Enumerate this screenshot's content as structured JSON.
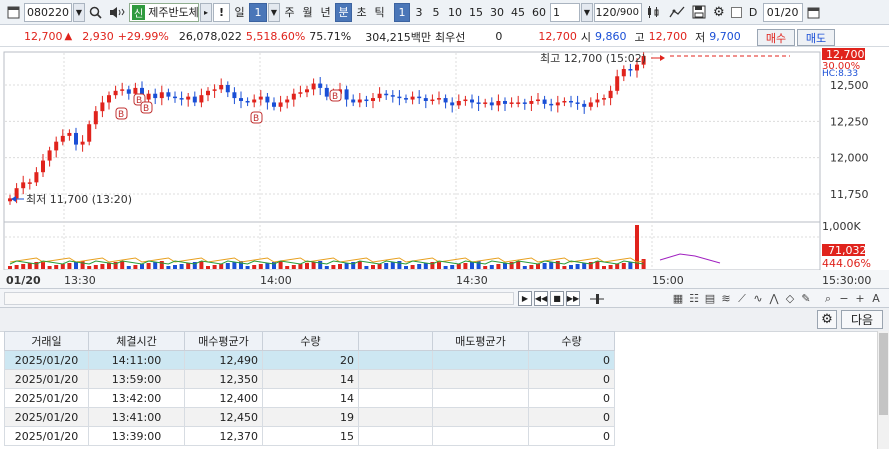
{
  "toolbar": {
    "code": "080220",
    "stock_tag": "신",
    "stock_name": "제주반도체",
    "alert": "!",
    "period_day": "일",
    "period_count": "1",
    "periods": [
      "주",
      "월",
      "년",
      "분",
      "초",
      "틱"
    ],
    "selected_period": "분",
    "minute_options": [
      "1",
      "3",
      "5",
      "10",
      "15",
      "30",
      "45",
      "60"
    ],
    "selected_minute": "1",
    "interval": "1",
    "bar_count": "120",
    "bar_total": "/900",
    "d_label": "D",
    "date": "01/20"
  },
  "quote": {
    "price": "12,700",
    "change": "2,930",
    "change_pct": "+29.99%",
    "volume": "26,078,022",
    "volume_pct": "5,518.60%",
    "rate": "75.71%",
    "amount": "304,215백만",
    "best": "최우선",
    "best_qty": "0",
    "best_price": "12,700",
    "open_label": "시",
    "open": "9,860",
    "high_label": "고",
    "high": "12,700",
    "low_label": "저",
    "low": "9,700",
    "buy_button": "매수",
    "sell_button": "매도"
  },
  "chart_data": {
    "type": "candlestick",
    "price_ticks": [
      "12,500",
      "12,250",
      "12,000",
      "11,750"
    ],
    "volume_tick": "1,000K",
    "time_ticks": [
      "01/20",
      "13:30",
      "14:00",
      "14:30",
      "15:00",
      "15:30:00"
    ],
    "current_price_label": "12,700",
    "current_pct_label": "30.00%",
    "current_extra_label": "HC:8.33",
    "current_volume_label": "71,032",
    "current_volume_pct_label": "444.06%",
    "high_annotation": "최고 12,700 (15:02)",
    "low_annotation": "최저 11,700 (13:20)",
    "colors": {
      "up": "#e0231c",
      "down": "#1a4fd6",
      "grid": "#dcdcdc"
    }
  },
  "panel": {
    "next_button": "다음",
    "columns": [
      "거래일",
      "체결시간",
      "매수평균가",
      "수량",
      "",
      "매도평균가",
      "수량"
    ],
    "rows": [
      [
        "2025/01/20",
        "14:11:00",
        "12,490",
        "20",
        "",
        "",
        "0"
      ],
      [
        "2025/01/20",
        "13:59:00",
        "12,350",
        "14",
        "",
        "",
        "0"
      ],
      [
        "2025/01/20",
        "13:42:00",
        "12,400",
        "14",
        "",
        "",
        "0"
      ],
      [
        "2025/01/20",
        "13:41:00",
        "12,450",
        "19",
        "",
        "",
        "0"
      ],
      [
        "2025/01/20",
        "13:39:00",
        "12,370",
        "15",
        "",
        "",
        "0"
      ]
    ]
  }
}
